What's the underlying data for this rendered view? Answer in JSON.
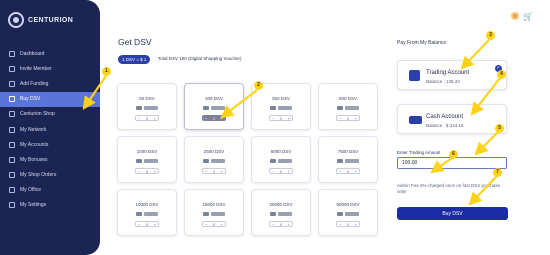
{
  "brand": {
    "name": "CENTURION"
  },
  "sidebar": {
    "items": [
      {
        "label": "Dashboard"
      },
      {
        "label": "Invite Member"
      },
      {
        "label": "Add Funding"
      },
      {
        "label": "Buy DSV",
        "active": true
      },
      {
        "label": "Centurion Shop"
      },
      {
        "label": "My Network"
      },
      {
        "label": "My Accounts"
      },
      {
        "label": "My Bonuses"
      },
      {
        "label": "My Shop Orders"
      },
      {
        "label": "My Office"
      },
      {
        "label": "My Settings"
      }
    ]
  },
  "header": {
    "title": "Get DSV"
  },
  "rate": {
    "chip": "1 DSV = $ 1",
    "note": "Total DSV 100 (Digital Shopping Voucher)"
  },
  "cards": [
    {
      "value": "50 DSV",
      "qty": "0"
    },
    {
      "value": "100 DSV",
      "qty": "1",
      "selected": true
    },
    {
      "value": "250 DSV",
      "qty": "0"
    },
    {
      "value": "500 DSV",
      "qty": "0"
    },
    {
      "value": "1000 DSV",
      "qty": "0"
    },
    {
      "value": "2500 DSV",
      "qty": "0"
    },
    {
      "value": "5000 DSV",
      "qty": "0"
    },
    {
      "value": "7500 DSV",
      "qty": "0"
    },
    {
      "value": "10000 DSV",
      "qty": "0"
    },
    {
      "value": "15000 DSV",
      "qty": "0"
    },
    {
      "value": "25000 DSV",
      "qty": "0"
    },
    {
      "value": "50000 DSV",
      "qty": "0"
    }
  ],
  "stepper": {
    "minus": "−",
    "plus": "+"
  },
  "payment": {
    "title": "Pay From My Balance",
    "trading": {
      "name": "Trading Account",
      "balance": "Balance : 135.43"
    },
    "cash": {
      "name": "Cash Account",
      "balance": "Balance : $ 344.16"
    },
    "amount_label": "Enter Trading Amount",
    "amount_value": "100.00",
    "note": "Admin Fee 3% charged once on first DSV purchase only!",
    "buy_label": "Buy DSV"
  },
  "annotations": [
    "1",
    "2",
    "3",
    "4",
    "5",
    "6",
    "7"
  ],
  "colors": {
    "sidebar": "#1b2554",
    "accent": "#2b3fa8",
    "annotation": "#ffd21a"
  },
  "icons": {
    "cart": "cart-icon",
    "settings": "gear-icon"
  }
}
